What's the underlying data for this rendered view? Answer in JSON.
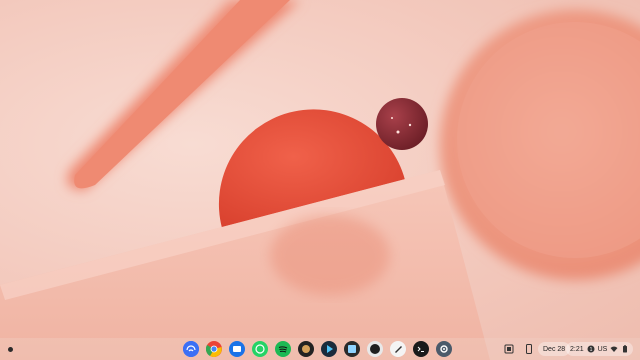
{
  "shelf": {
    "launcher_icon": "launcher-circle-icon",
    "apps": [
      {
        "name": "files-sync",
        "icon": "sync-icon",
        "color": "#3b6ff5"
      },
      {
        "name": "chrome",
        "icon": "chrome-icon",
        "color": "#ea4335"
      },
      {
        "name": "files",
        "icon": "folder-icon",
        "color": "#1a73e8"
      },
      {
        "name": "whatsapp",
        "icon": "chat-icon",
        "color": "#25d366"
      },
      {
        "name": "spotify",
        "icon": "spotify-icon",
        "color": "#1db954"
      },
      {
        "name": "game",
        "icon": "gamepad-icon",
        "color": "#222222"
      },
      {
        "name": "playstore",
        "icon": "play-icon",
        "color": "#333333"
      },
      {
        "name": "photos",
        "icon": "image-icon",
        "color": "#2a2a2a"
      },
      {
        "name": "github",
        "icon": "github-icon",
        "color": "#1f1f1f"
      },
      {
        "name": "inkscape",
        "icon": "pen-icon",
        "color": "#ffffff"
      },
      {
        "name": "terminal",
        "icon": "terminal-icon",
        "color": "#1a1a1a"
      },
      {
        "name": "settings",
        "icon": "gear-icon",
        "color": "#4a5a6a"
      }
    ]
  },
  "tray": {
    "date": "Dec 28",
    "time": "2:21",
    "locale": "US"
  }
}
